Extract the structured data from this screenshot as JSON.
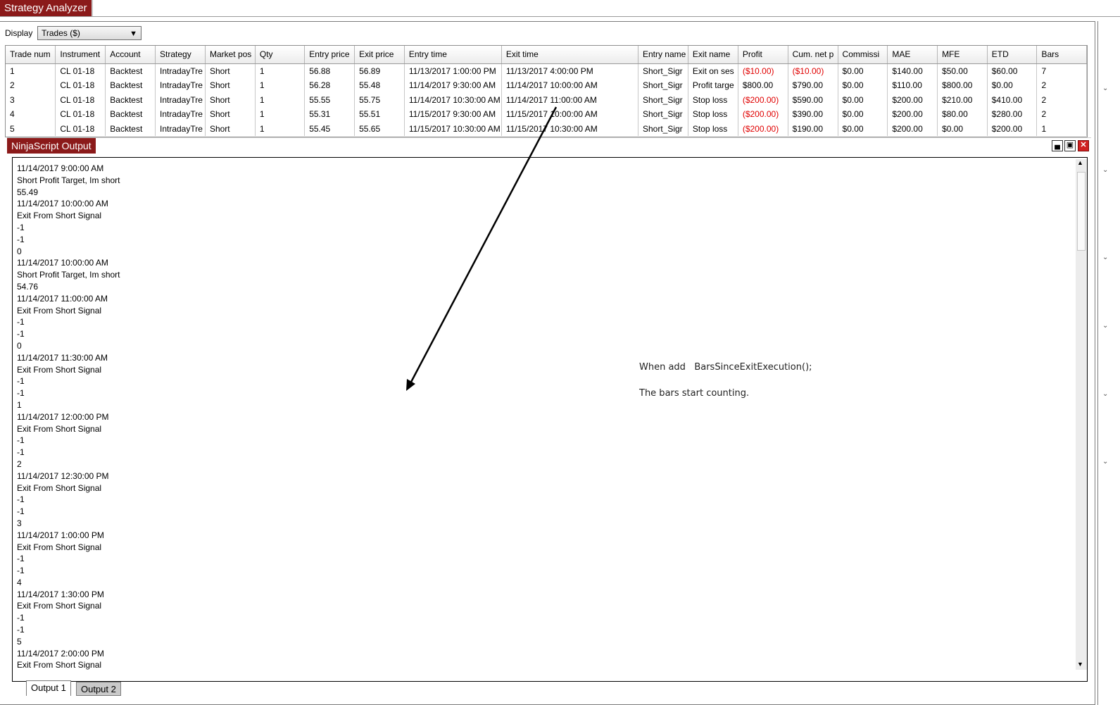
{
  "app": {
    "title": "Strategy Analyzer"
  },
  "display": {
    "label": "Display",
    "selected": "Trades ($)"
  },
  "trades": {
    "columns": [
      "Trade num",
      "Instrument",
      "Account",
      "Strategy",
      "Market pos",
      "Qty",
      "Entry price",
      "Exit price",
      "Entry time",
      "Exit time",
      "Entry name",
      "Exit name",
      "Profit",
      "Cum. net p",
      "Commissi",
      "MAE",
      "MFE",
      "ETD",
      "Bars"
    ],
    "rows": [
      [
        "1",
        "CL 01-18",
        "Backtest",
        "IntradayTre",
        "Short",
        "1",
        "56.88",
        "56.89",
        "11/13/2017 1:00:00 PM",
        "11/13/2017 4:00:00 PM",
        "Short_Sigr",
        "Exit on ses",
        "($10.00)",
        "($10.00)",
        "$0.00",
        "$140.00",
        "$50.00",
        "$60.00",
        "7"
      ],
      [
        "2",
        "CL 01-18",
        "Backtest",
        "IntradayTre",
        "Short",
        "1",
        "56.28",
        "55.48",
        "11/14/2017 9:30:00 AM",
        "11/14/2017 10:00:00 AM",
        "Short_Sigr",
        "Profit targe",
        "$800.00",
        "$790.00",
        "$0.00",
        "$110.00",
        "$800.00",
        "$0.00",
        "2"
      ],
      [
        "3",
        "CL 01-18",
        "Backtest",
        "IntradayTre",
        "Short",
        "1",
        "55.55",
        "55.75",
        "11/14/2017 10:30:00 AM",
        "11/14/2017 11:00:00 AM",
        "Short_Sigr",
        "Stop loss",
        "($200.00)",
        "$590.00",
        "$0.00",
        "$200.00",
        "$210.00",
        "$410.00",
        "2"
      ],
      [
        "4",
        "CL 01-18",
        "Backtest",
        "IntradayTre",
        "Short",
        "1",
        "55.31",
        "55.51",
        "11/15/2017 9:30:00 AM",
        "11/15/2017 10:00:00 AM",
        "Short_Sigr",
        "Stop loss",
        "($200.00)",
        "$390.00",
        "$0.00",
        "$200.00",
        "$80.00",
        "$280.00",
        "2"
      ],
      [
        "5",
        "CL 01-18",
        "Backtest",
        "IntradayTre",
        "Short",
        "1",
        "55.45",
        "55.65",
        "11/15/2017 10:30:00 AM",
        "11/15/2017 10:30:00 AM",
        "Short_Sigr",
        "Stop loss",
        "($200.00)",
        "$190.00",
        "$0.00",
        "$200.00",
        "$0.00",
        "$200.00",
        "1"
      ]
    ],
    "negative_color": "#e00000"
  },
  "output_window": {
    "title": "NinjaScript Output",
    "lines": [
      "11/14/2017 9:00:00 AM",
      "Short Profit Target, Im short",
      "55.49",
      "11/14/2017 10:00:00 AM",
      "Exit From Short Signal",
      "-1",
      "-1",
      "0",
      "11/14/2017 10:00:00 AM",
      "Short Profit Target, Im short",
      "54.76",
      "11/14/2017 11:00:00 AM",
      "Exit From Short Signal",
      "-1",
      "-1",
      "0",
      "11/14/2017 11:30:00 AM",
      "Exit From Short Signal",
      "-1",
      "-1",
      "1",
      "11/14/2017 12:00:00 PM",
      "Exit From Short Signal",
      "-1",
      "-1",
      "2",
      "11/14/2017 12:30:00 PM",
      "Exit From Short Signal",
      "-1",
      "-1",
      "3",
      "11/14/2017 1:00:00 PM",
      "Exit From Short Signal",
      "-1",
      "-1",
      "4",
      "11/14/2017 1:30:00 PM",
      "Exit From Short Signal",
      "-1",
      "-1",
      "5",
      "11/14/2017 2:00:00 PM",
      "Exit From Short Signal"
    ],
    "tabs": [
      "Output 1",
      "Output 2"
    ],
    "active_tab": "Output 1"
  },
  "annotation": {
    "line1": "When add   BarsSinceExitExecution();",
    "line2": "The bars start counting."
  },
  "colors": {
    "title_bar": "#8b1a1a",
    "close_button": "#d02020"
  },
  "icons": [
    "chevron-down-icon",
    "minimize-icon",
    "maximize-icon",
    "close-icon",
    "scroll-up-icon",
    "scroll-down-icon",
    "arrow-annotation-icon"
  ]
}
